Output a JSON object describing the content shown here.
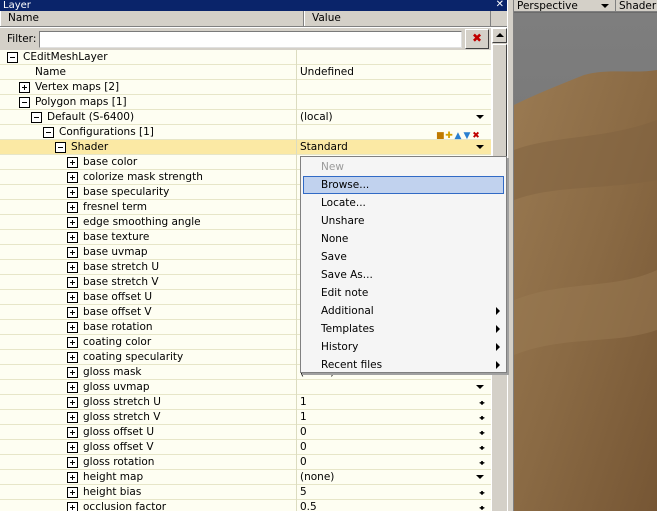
{
  "window": {
    "title": "Layer",
    "close_glyph": "✕"
  },
  "columns": {
    "name": "Name",
    "value": "Value"
  },
  "filter": {
    "label": "Filter:",
    "value": "",
    "clear_glyph": "✖"
  },
  "tree": [
    {
      "label": "CEditMeshLayer",
      "indent": 0,
      "expander": "minus",
      "value": "",
      "control": ""
    },
    {
      "label": "Name",
      "indent": 1,
      "expander": "",
      "value": "Undefined",
      "control": ""
    },
    {
      "label": "Vertex maps [2]",
      "indent": 1,
      "expander": "plus",
      "value": "",
      "control": ""
    },
    {
      "label": "Polygon maps [1]",
      "indent": 1,
      "expander": "minus",
      "value": "",
      "control": ""
    },
    {
      "label": "Default (S-6400)",
      "indent": 2,
      "expander": "minus",
      "value": "(local)",
      "control": "dropdown"
    },
    {
      "label": "Configurations [1]",
      "indent": 3,
      "expander": "minus",
      "value": "",
      "control": "config-icons"
    },
    {
      "label": "Shader",
      "indent": 4,
      "expander": "minus",
      "value": "Standard",
      "control": "dropdown",
      "selected": true
    },
    {
      "label": "base color",
      "indent": 5,
      "expander": "plus",
      "value": "",
      "control": ""
    },
    {
      "label": "colorize mask strength",
      "indent": 5,
      "expander": "plus",
      "value": "",
      "control": ""
    },
    {
      "label": "base specularity",
      "indent": 5,
      "expander": "plus",
      "value": "",
      "control": ""
    },
    {
      "label": "fresnel term",
      "indent": 5,
      "expander": "plus",
      "value": "",
      "control": ""
    },
    {
      "label": "edge smoothing angle",
      "indent": 5,
      "expander": "plus",
      "value": "",
      "control": ""
    },
    {
      "label": "base texture",
      "indent": 5,
      "expander": "plus",
      "value": "",
      "control": ""
    },
    {
      "label": "base uvmap",
      "indent": 5,
      "expander": "plus",
      "value": "",
      "control": ""
    },
    {
      "label": "base stretch U",
      "indent": 5,
      "expander": "plus",
      "value": "",
      "control": ""
    },
    {
      "label": "base stretch V",
      "indent": 5,
      "expander": "plus",
      "value": "",
      "control": ""
    },
    {
      "label": "base offset U",
      "indent": 5,
      "expander": "plus",
      "value": "",
      "control": ""
    },
    {
      "label": "base offset V",
      "indent": 5,
      "expander": "plus",
      "value": "",
      "control": ""
    },
    {
      "label": "base rotation",
      "indent": 5,
      "expander": "plus",
      "value": "",
      "control": ""
    },
    {
      "label": "coating color",
      "indent": 5,
      "expander": "plus",
      "value": "",
      "control": ""
    },
    {
      "label": "coating specularity",
      "indent": 5,
      "expander": "plus",
      "value": "",
      "control": ""
    },
    {
      "label": "gloss mask",
      "indent": 5,
      "expander": "plus",
      "value": "(none)",
      "control": ""
    },
    {
      "label": "gloss uvmap",
      "indent": 5,
      "expander": "plus",
      "value": "",
      "control": "dropdown"
    },
    {
      "label": "gloss stretch U",
      "indent": 5,
      "expander": "plus",
      "value": "1",
      "control": "spinner"
    },
    {
      "label": "gloss stretch V",
      "indent": 5,
      "expander": "plus",
      "value": "1",
      "control": "spinner"
    },
    {
      "label": "gloss offset U",
      "indent": 5,
      "expander": "plus",
      "value": "0",
      "control": "spinner"
    },
    {
      "label": "gloss offset V",
      "indent": 5,
      "expander": "plus",
      "value": "0",
      "control": "spinner"
    },
    {
      "label": "gloss rotation",
      "indent": 5,
      "expander": "plus",
      "value": "0",
      "control": "spinner"
    },
    {
      "label": "height map",
      "indent": 5,
      "expander": "plus",
      "value": "(none)",
      "control": "dropdown"
    },
    {
      "label": "height bias",
      "indent": 5,
      "expander": "plus",
      "value": "5",
      "control": "spinner"
    },
    {
      "label": "occlusion factor",
      "indent": 5,
      "expander": "plus",
      "value": "0.5",
      "control": "spinner"
    }
  ],
  "context_menu": [
    {
      "label": "New",
      "disabled": true,
      "submenu": false
    },
    {
      "label": "Browse...",
      "highlighted": true,
      "submenu": false
    },
    {
      "label": "Locate...",
      "submenu": false
    },
    {
      "label": "Unshare",
      "submenu": false
    },
    {
      "label": "None",
      "submenu": false
    },
    {
      "label": "Save",
      "submenu": false
    },
    {
      "label": "Save As...",
      "submenu": false
    },
    {
      "label": "Edit note",
      "submenu": false
    },
    {
      "label": "Additional",
      "submenu": true
    },
    {
      "label": "Templates",
      "submenu": true
    },
    {
      "label": "History",
      "submenu": true
    },
    {
      "label": "Recent files",
      "submenu": true
    }
  ],
  "viewport": {
    "view_label": "Perspective",
    "shader_label": "Shader"
  },
  "colors": {
    "title_bar": "#0a246a",
    "selected_row": "#fbe9a4",
    "menu_highlight": "#c1d2ee",
    "terrain": "#8a6a44"
  }
}
